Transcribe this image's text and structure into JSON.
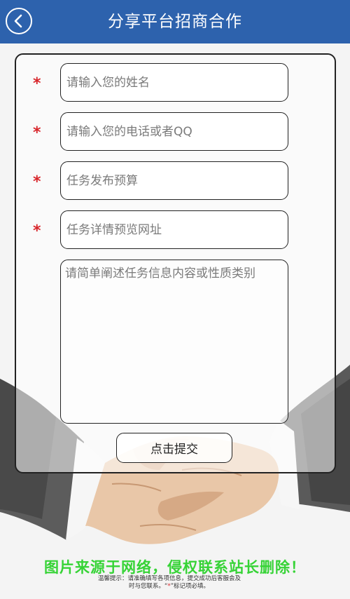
{
  "header": {
    "title": "分享平台招商合作"
  },
  "form": {
    "fields": [
      {
        "placeholder": "请输入您的姓名",
        "required": true
      },
      {
        "placeholder": "请输入您的电话或者QQ",
        "required": true
      },
      {
        "placeholder": "任务发布预算",
        "required": true
      },
      {
        "placeholder": "任务详情预览网址",
        "required": true
      }
    ],
    "required_mark": "*",
    "description_placeholder": "请简单阐述任务信息内容或性质类别",
    "submit_label": "点击提交"
  },
  "watermark": "图片来源于网络，侵权联系站长删除！",
  "tip": {
    "line1": "温馨提示：请准确填写各项信息，提交成功后客服会及",
    "line2_a": "时与您联系。“",
    "line2_star": "*",
    "line2_b": "”标记项必填。"
  },
  "colors": {
    "header_bg": "#2d62ad",
    "required_star": "#d8262b",
    "watermark": "#36d336"
  }
}
